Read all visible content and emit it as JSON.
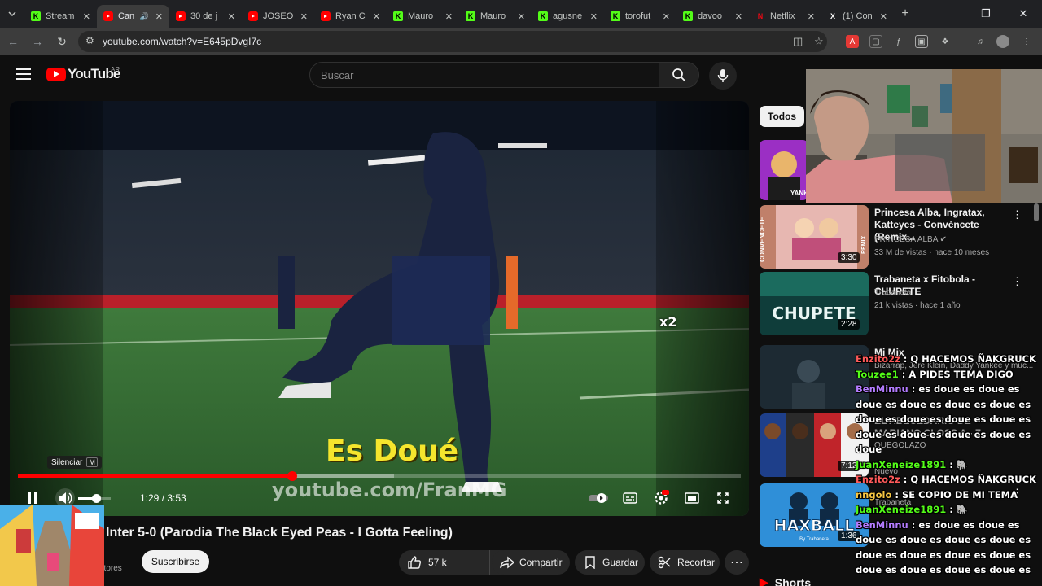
{
  "browser": {
    "tabs": [
      {
        "title": "Stream",
        "favicon": "kick-icon",
        "color": "#53fc18"
      },
      {
        "title": "Can",
        "favicon": "youtube-icon",
        "color": "#ff0000",
        "active": true,
        "audio": true
      },
      {
        "title": "30 de j",
        "favicon": "youtube-icon",
        "color": "#ff0000"
      },
      {
        "title": "JOSEO",
        "favicon": "youtube-icon",
        "color": "#ff0000"
      },
      {
        "title": "Ryan C",
        "favicon": "youtube-icon",
        "color": "#ff0000"
      },
      {
        "title": "Mauro",
        "favicon": "kick-icon",
        "color": "#53fc18"
      },
      {
        "title": "Mauro",
        "favicon": "kick-icon",
        "color": "#53fc18"
      },
      {
        "title": "agusne",
        "favicon": "kick-icon",
        "color": "#53fc18"
      },
      {
        "title": "torofut",
        "favicon": "kick-icon",
        "color": "#53fc18"
      },
      {
        "title": "davoo",
        "favicon": "kick-icon",
        "color": "#53fc18"
      },
      {
        "title": "Netflix",
        "favicon": "netflix-icon",
        "color": "#e50914"
      },
      {
        "title": "(1) Con",
        "favicon": "x-icon",
        "color": "#ffffff"
      }
    ],
    "url": "youtube.com/watch?v=E645pDvgI7c"
  },
  "youtube": {
    "logo": "YouTube",
    "region": "AR",
    "search_placeholder": "Buscar"
  },
  "player": {
    "overlay_title": "Es Doué",
    "watermark": "youtube.com/FranMG",
    "multiplier": "x2",
    "mute_tooltip": "Silenciar",
    "mute_key": "M",
    "time": "1:29 / 3:53",
    "progress": 0.38,
    "buffered": 0.52,
    "volume": 0.55
  },
  "video": {
    "title": "Inter 5-0 (Parodia The Black Eyed Peas - I Gotta Feeling)",
    "channel_subs_partial": "ptores",
    "subscribe": "Suscribirse",
    "likes": "57 k",
    "share": "Compartir",
    "save": "Guardar",
    "clip": "Recortar"
  },
  "sidebar": {
    "chip": "Todos",
    "cards": [
      {
        "title": "Princesa Alba, Ingratax, Katteyes - Convéncete (Remix...",
        "channel": "PRINCESA ALBA",
        "stats": "33 M de vistas · hace 10 meses",
        "duration": "3:30"
      },
      {
        "title": "Trabaneta x Fitobola - CHUPETE",
        "channel": "Trabaneta",
        "stats": "21 k vistas · hace 1 año",
        "duration": "2:28"
      },
      {
        "title": "Mi Mix",
        "channel": "Bizarrap, Jere Klein, Daddy Yankee y muc...",
        "stats": "",
        "duration": ""
      },
      {
        "title": "EL ABECEDARIO DE MARIANO CLOSS A - Z",
        "channel": "QUEGOLAZO",
        "stats": "Nuevo",
        "duration": "7:12"
      },
      {
        "title": "",
        "channel": "Trabaneta",
        "stats": "",
        "duration": "1:36"
      }
    ],
    "top_card_thumb_text": "YANK",
    "shorts": "Shorts"
  },
  "thumb_texts": {
    "chupete": "CHUPETE",
    "haxball": "HAXBALL",
    "haxball_sub": "By Trabaneta",
    "convencete": "CONVÉNCETE",
    "remix": "REMIX"
  },
  "chat": [
    {
      "user": "Enzito2z",
      "text": "Q HACEMOS ÑAKGRUCK",
      "color": "#ff5a5a"
    },
    {
      "user": "Touzee1",
      "text": "A PIDES TEMA DIGO",
      "color": "#53fc18"
    },
    {
      "user": "BenMinnu",
      "text": "es doue es doue es doue es doue es doue es doue es doue es doue es doue es doue es doue es doue es doue es doue es doue",
      "color": "#b47cff"
    },
    {
      "user": "JuanXeneize1891",
      "text": "🐘",
      "color": "#53fc18"
    },
    {
      "user": "Enzito2z",
      "text": "Q HACEMOS ÑAKGRUCK",
      "color": "#ff5a5a"
    },
    {
      "user": "nngolo",
      "text": "SE COPIO DE MI TEMA",
      "color": "#f5c542"
    },
    {
      "user": "JuanXeneize1891",
      "text": "🐘",
      "color": "#53fc18"
    },
    {
      "user": "BenMinnu",
      "text": "es doue es doue es doue es doue es doue es doue es doue es doue es doue es doue es doue es doue es doue es doue es",
      "color": "#b47cff"
    }
  ]
}
